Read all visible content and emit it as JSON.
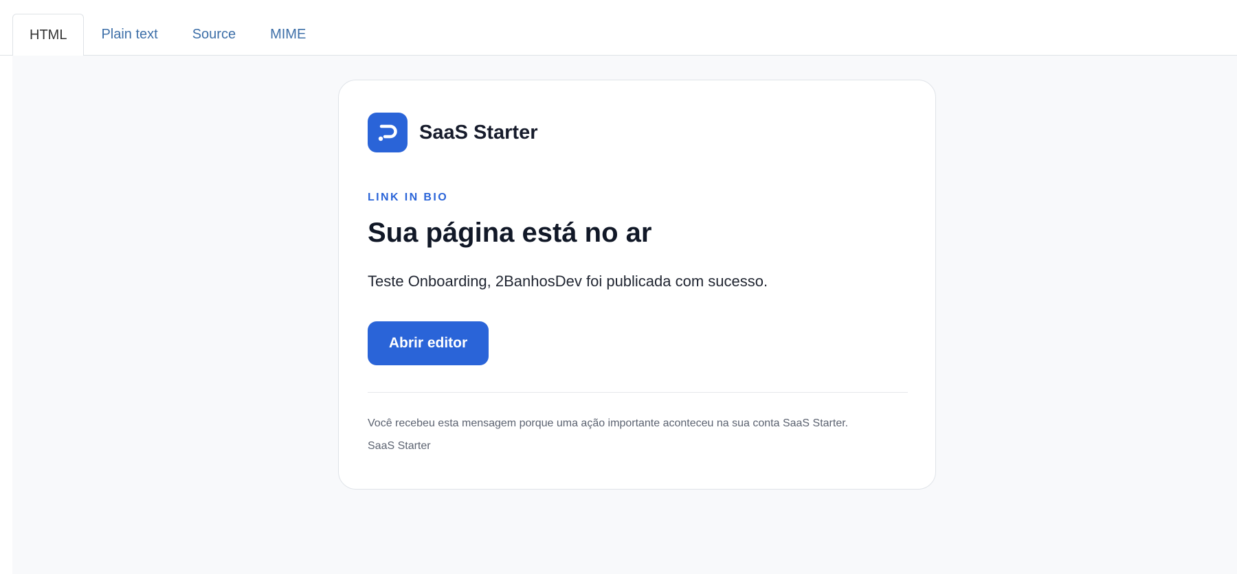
{
  "tabs": [
    {
      "label": "HTML",
      "active": true
    },
    {
      "label": "Plain text",
      "active": false
    },
    {
      "label": "Source",
      "active": false
    },
    {
      "label": "MIME",
      "active": false
    }
  ],
  "email": {
    "brand": {
      "logo_icon": "brand-p-logo-icon",
      "name": "SaaS Starter"
    },
    "eyebrow": "LINK IN BIO",
    "headline": "Sua página está no ar",
    "body": "Teste Onboarding, 2BanhosDev foi publicada com sucesso.",
    "cta_label": "Abrir editor",
    "footer": {
      "notice": "Você recebeu esta mensagem porque uma ação importante aconteceu na sua conta SaaS Starter.",
      "signature": "SaaS Starter"
    }
  },
  "colors": {
    "accent": "#2a64d8",
    "tab_link": "#3d6fa8",
    "preview_bg": "#f8f9fb"
  }
}
